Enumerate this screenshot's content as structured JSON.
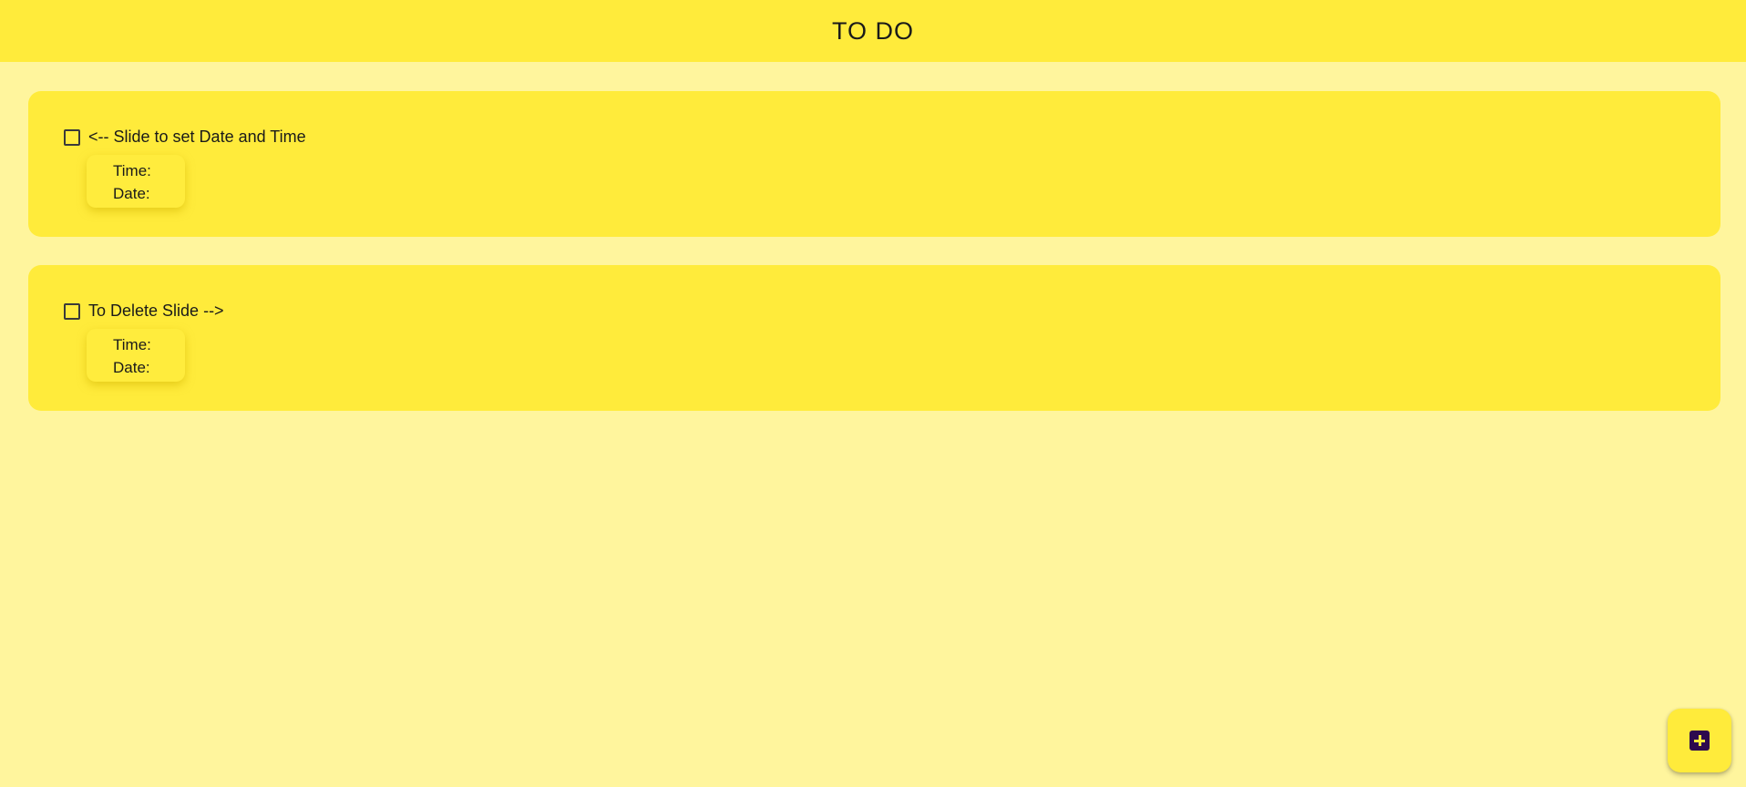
{
  "app_bar": {
    "title": "TO DO"
  },
  "todos": [
    {
      "text": "<-- Slide to set Date and Time",
      "checked": false,
      "time_label": "Time:",
      "date_label": "Date:"
    },
    {
      "text": "To Delete Slide -->",
      "checked": false,
      "time_label": "Time:",
      "date_label": "Date:"
    }
  ],
  "fab": {
    "icon": "add-box-icon"
  },
  "colors": {
    "background": "#fff59d",
    "accent": "#ffeb3b",
    "fab_icon": "#2d0a4e"
  }
}
